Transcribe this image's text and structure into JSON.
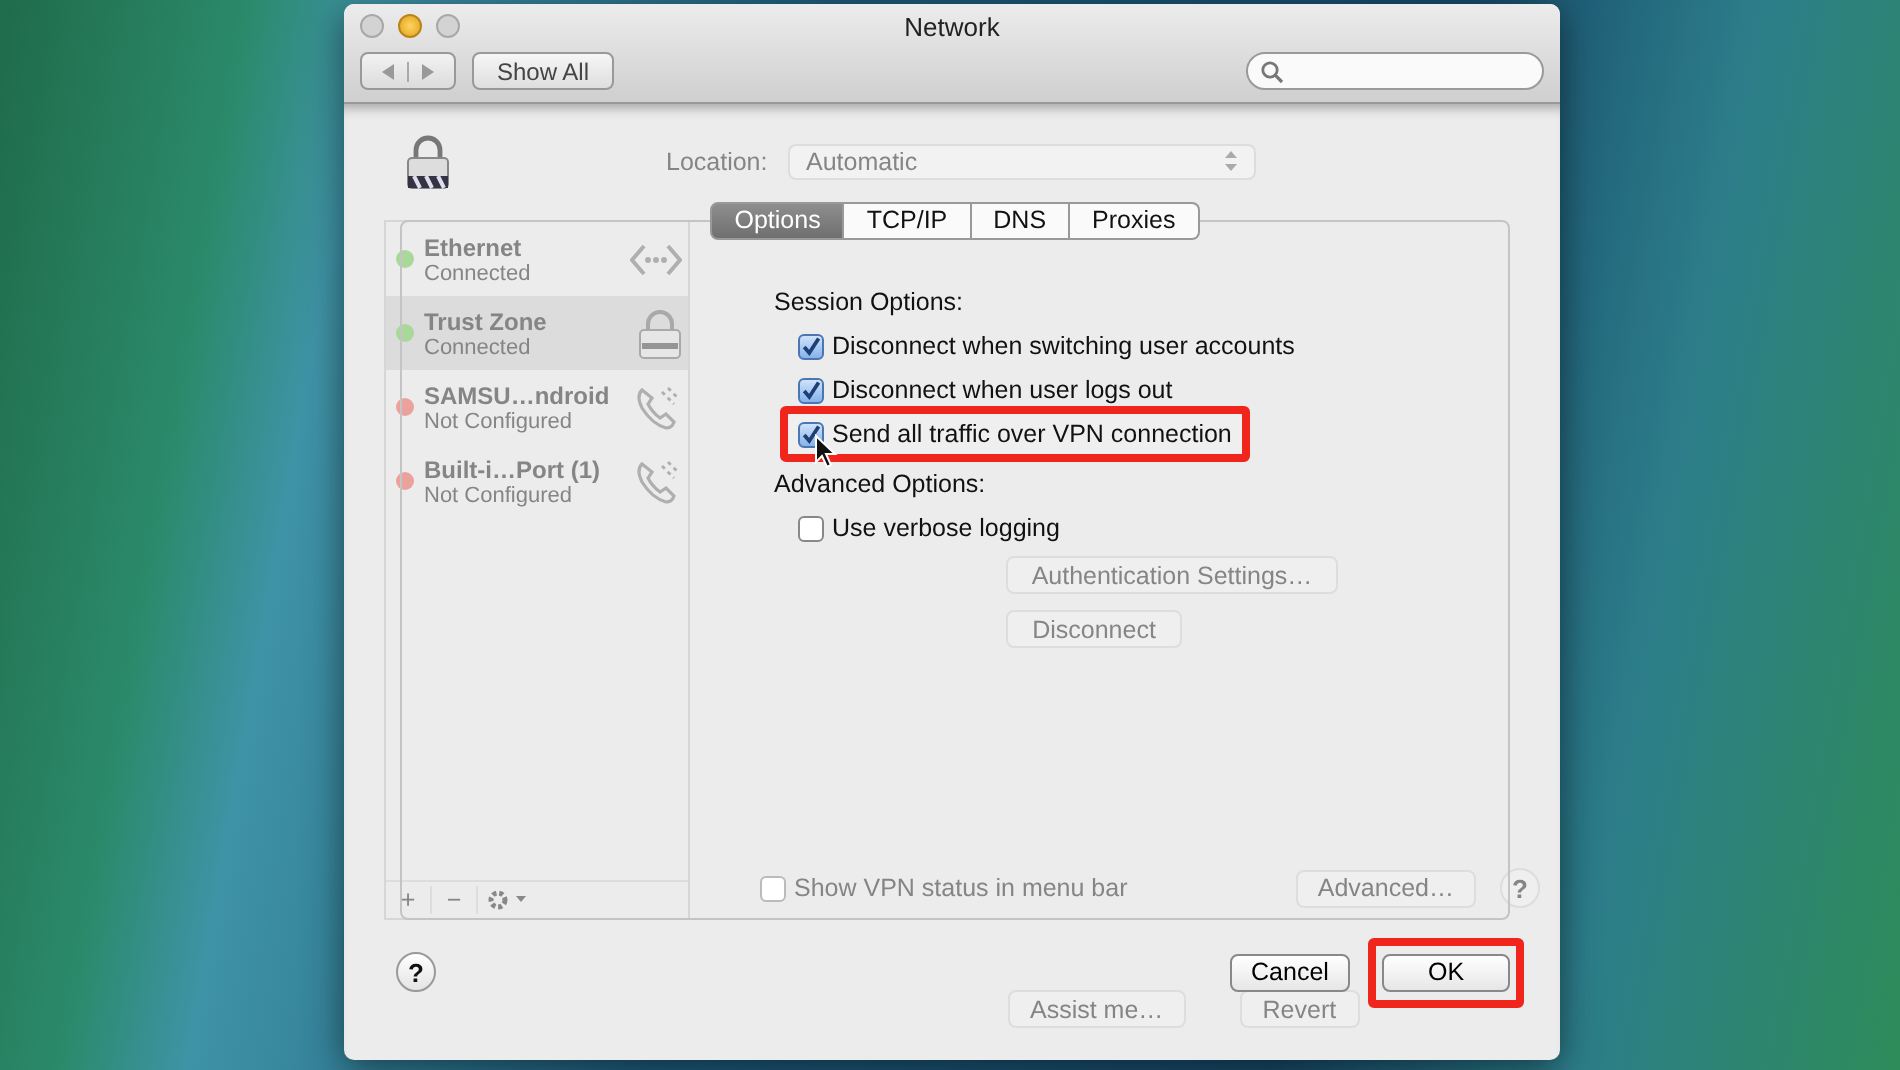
{
  "window": {
    "title": "Network",
    "show_all": "Show All"
  },
  "location": {
    "label": "Location:",
    "value": "Automatic"
  },
  "services": [
    {
      "name": "Ethernet",
      "status": "Connected",
      "color": "#a9d89a",
      "selected": false,
      "kind": "ethernet"
    },
    {
      "name": "Trust Zone",
      "status": "Connected",
      "color": "#a9d89a",
      "selected": true,
      "kind": "vpn"
    },
    {
      "name": "SAMSU…ndroid",
      "status": "Not Configured",
      "color": "#eba19c",
      "selected": false,
      "kind": "phone"
    },
    {
      "name": "Built-i…Port (1)",
      "status": "Not Configured",
      "color": "#eba19c",
      "selected": false,
      "kind": "phone"
    }
  ],
  "service_buttons": [
    "+",
    "−"
  ],
  "vpn_pane": {
    "buttons": [
      "Authentication Settings…",
      "Disconnect"
    ],
    "show_status": {
      "label": "Show VPN status in menu bar",
      "checked": false
    },
    "advanced": "Advanced…",
    "help": "?"
  },
  "footer_buttons": [
    "Assist me…",
    "Revert"
  ],
  "sheet": {
    "tabs": [
      {
        "label": "Options",
        "selected": true
      },
      {
        "label": "TCP/IP",
        "selected": false
      },
      {
        "label": "DNS",
        "selected": false
      },
      {
        "label": "Proxies",
        "selected": false
      }
    ],
    "sections": [
      {
        "title": "Session Options:",
        "options": [
          {
            "label": "Disconnect when switching user accounts",
            "checked": true,
            "highlighted": false
          },
          {
            "label": "Disconnect when user logs out",
            "checked": true,
            "highlighted": false
          },
          {
            "label": "Send all traffic over VPN connection",
            "checked": true,
            "highlighted": true
          }
        ]
      },
      {
        "title": "Advanced Options:",
        "options": [
          {
            "label": "Use verbose logging",
            "checked": false,
            "highlighted": false
          }
        ]
      }
    ],
    "help": "?",
    "cancel": "Cancel",
    "ok": "OK",
    "ok_highlighted": true
  }
}
